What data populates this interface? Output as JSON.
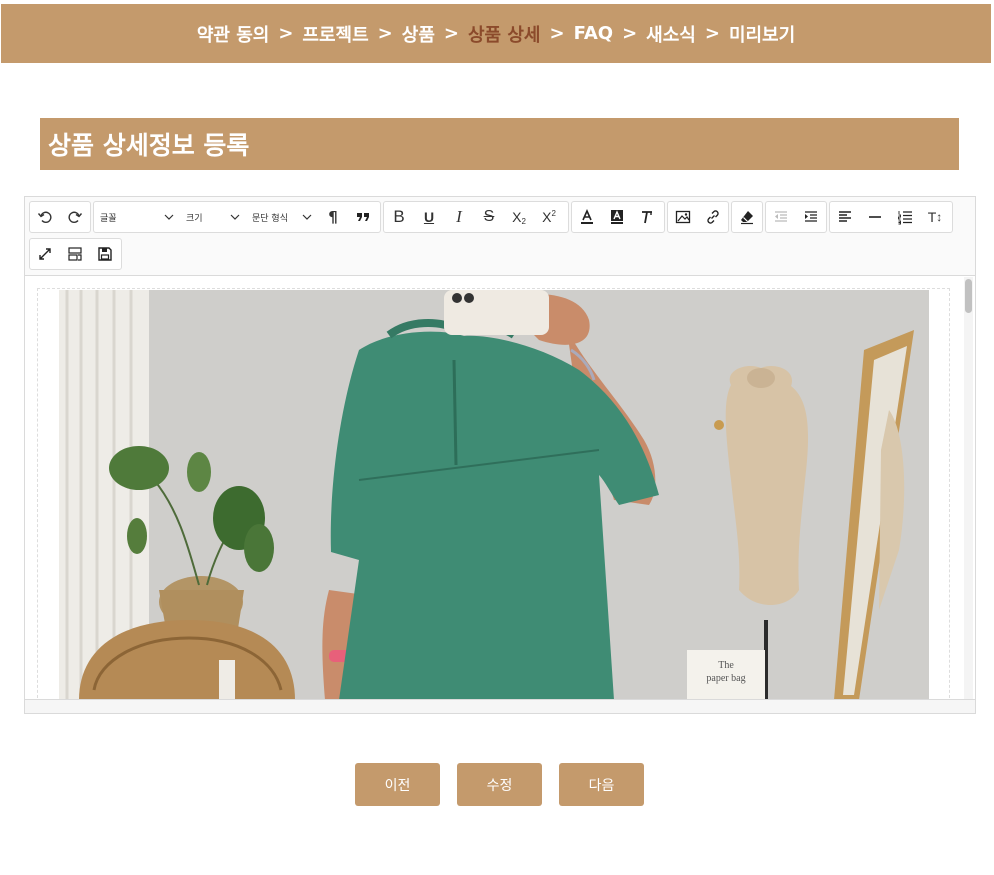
{
  "steps": [
    {
      "label": "약관 동의",
      "active": false
    },
    {
      "label": "프로젝트",
      "active": false
    },
    {
      "label": "상품",
      "active": false
    },
    {
      "label": "상품 상세",
      "active": true
    },
    {
      "label": "FAQ",
      "active": false
    },
    {
      "label": "새소식",
      "active": false
    },
    {
      "label": "미리보기",
      "active": false
    }
  ],
  "step_separator": ">",
  "section_title": "상품 상세정보 등록",
  "toolbar": {
    "font_select": "글꼴",
    "size_select": "크기",
    "format_select": "문단 형식",
    "icons": [
      "undo-icon",
      "redo-icon",
      "paragraph-icon",
      "blockquote-icon",
      "bold-icon",
      "underline-icon",
      "italic-icon",
      "strikethrough-icon",
      "subscript-icon",
      "superscript-icon",
      "font-color-icon",
      "highlight-color-icon",
      "text-style-icon",
      "image-icon",
      "link-icon",
      "remove-format-icon",
      "outdent-icon",
      "indent-icon",
      "align-icon",
      "horizontal-rule-icon",
      "list-icon",
      "line-height-icon",
      "fullscreen-icon",
      "show-blocks-icon",
      "save-icon"
    ]
  },
  "photo": {
    "book_text_line1": "The",
    "book_text_line2": "paper bag"
  },
  "buttons": {
    "prev": "이전",
    "edit": "수정",
    "next": "다음"
  },
  "colors": {
    "accent": "#c49a6c",
    "active_step": "#8b4a2b",
    "shirt": "#3f8c74"
  }
}
